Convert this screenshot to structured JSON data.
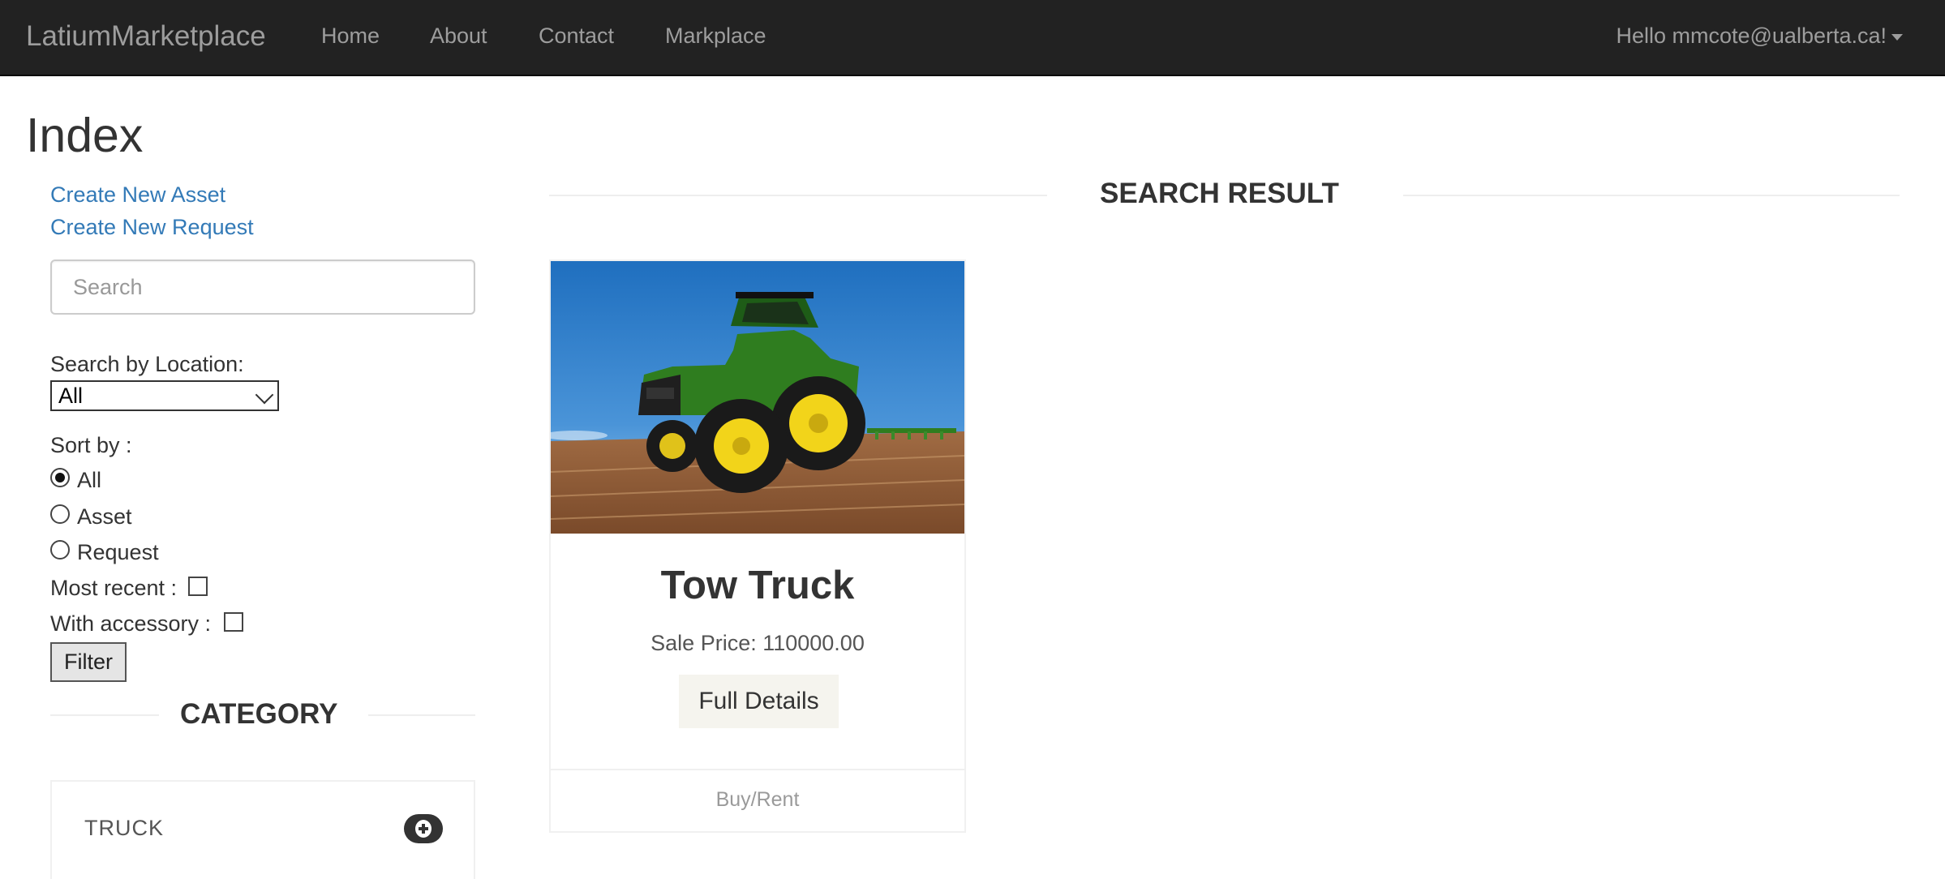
{
  "navbar": {
    "brand": "LatiumMarketplace",
    "links": [
      "Home",
      "About",
      "Contact",
      "Markplace"
    ],
    "user": "Hello mmcote@ualberta.ca!"
  },
  "page": {
    "title": "Index"
  },
  "sidebar": {
    "create_asset": "Create New Asset",
    "create_request": "Create New Request",
    "search_placeholder": "Search",
    "location_label": "Search by Location:",
    "location_selected": "All",
    "sort_label": "Sort by :",
    "sort_options": [
      "All",
      "Asset",
      "Request"
    ],
    "sort_selected": "All",
    "most_recent_label": "Most recent :",
    "with_accessory_label": "With accessory :",
    "filter_button": "Filter",
    "category_heading": "CATEGORY",
    "categories": [
      "TRUCK"
    ]
  },
  "results": {
    "heading": "SEARCH RESULT",
    "items": [
      {
        "title": "Tow Truck",
        "price": "Sale Price: 110000.00",
        "details_button": "Full Details",
        "footer": "Buy/Rent"
      }
    ]
  },
  "colors": {
    "navbar_bg": "#222222",
    "nav_text": "#9d9d9d",
    "link": "#337ab7",
    "tractor_green": "#2f7d1f",
    "tractor_yellow": "#f2d41a"
  },
  "icons": {
    "user_caret": "caret-down-icon",
    "category_expand": "plus-circle-icon"
  }
}
